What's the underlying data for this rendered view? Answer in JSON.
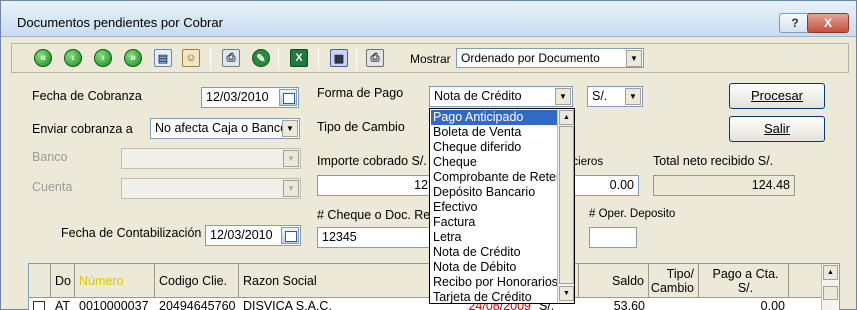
{
  "window": {
    "title": "Documentos pendientes por Cobrar",
    "help_label": "?",
    "close_label": "X"
  },
  "toolbar": {
    "mostrar_label": "Mostrar",
    "mostrar_value": "Ordenado por Documento"
  },
  "form": {
    "fecha_cobranza_label": "Fecha de Cobranza",
    "fecha_cobranza_value": "12/03/2010",
    "enviar_label": "Enviar cobranza a",
    "enviar_value": "No afecta Caja o Banco",
    "banco_label": "Banco",
    "cuenta_label": "Cuenta",
    "fecha_contab_label": "Fecha de Contabilización",
    "fecha_contab_value": "12/03/2010",
    "forma_pago_label": "Forma de Pago",
    "forma_pago_value": "Nota de Crédito",
    "moneda_value": "S/.",
    "tipo_cambio_label": "Tipo de Cambio",
    "importe_label": "Importe cobrado S/.",
    "importe_value": "12",
    "financieros_label": "ncieros",
    "financieros_value": "0.00",
    "total_label": "Total neto recibido S/.",
    "total_value": "124.48",
    "cheque_label": "# Cheque o Doc. Re",
    "cheque_value": "12345",
    "oper_label": "# Oper. Deposito",
    "oper_value": ""
  },
  "buttons": {
    "procesar": "Procesar",
    "salir": "Salir"
  },
  "dropdown": {
    "items": [
      "Pago Anticipado",
      "Boleta de Venta",
      "Cheque diferido",
      "Cheque",
      "Comprobante de Reter",
      "Depósito Bancario",
      "Efectivo",
      "Factura",
      "Letra",
      "Nota de Crédito",
      "Nota de Débito",
      "Recibo por Honorarios",
      "Tarjeta de Crédito"
    ],
    "selected_index": 0
  },
  "grid": {
    "headers": {
      "do": "Do",
      "numero": "Número",
      "codigo": "Codigo Clie.",
      "razon": "Razon Social",
      "saldo": "Saldo",
      "tipo_cambio": "Tipo/\nCambio",
      "pago": "Pago a Cta.\nS/."
    },
    "row": {
      "do": "AT",
      "numero": "0010000037",
      "codigo": "20494645760",
      "razon": "DISVICA S.A.C.",
      "fecha": "24/08/2009",
      "moneda": "S/.",
      "saldo": "53.60",
      "pago": "0.00"
    }
  },
  "colors": {
    "numero_header": "#ffff00",
    "highlight": "#316ac5",
    "date_red": "#d00000"
  },
  "icons": {
    "nav": [
      "first-icon",
      "prev-icon",
      "next-icon",
      "last-icon"
    ],
    "tools": [
      "document-icon",
      "users-icon",
      "print-preview-icon",
      "pin-icon",
      "excel-icon",
      "calculator-icon",
      "printer-icon"
    ]
  }
}
